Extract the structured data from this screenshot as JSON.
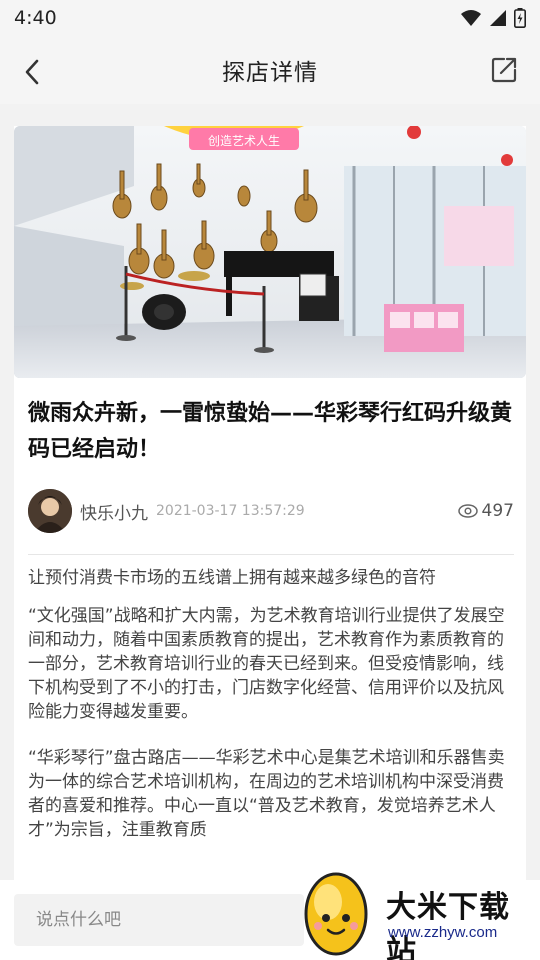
{
  "status_bar": {
    "time": "4:40"
  },
  "nav": {
    "title": "探店详情"
  },
  "article": {
    "title": "微雨众卉新，一雷惊蛰始——华彩琴行红码升级黄码已经启动！",
    "author": "快乐小九",
    "datetime": "2021-03-17 13:57:29",
    "views": "497",
    "hero_banner_text": "创造艺术人生",
    "paragraphs": [
      "让预付消费卡市场的五线谱上拥有越来越多绿色的音符",
      "“文化强国”战略和扩大内需，为艺术教育培训行业提供了发展空间和动力，随着中国素质教育的提出，艺术教育作为素质教育的一部分，艺术教育培训行业的春天已经到来。但受疫情影响，线下机构受到了不小的打击，门店数字化经营、信用评价以及抗风险能力变得越发重要。",
      "“华彩琴行”盘古路店——华彩艺术中心是集艺术培训和乐器售卖为一体的综合艺术培训机构，在周边的艺术培训机构中深受消费者的喜爱和推荐。中心一直以“普及艺术教育，发觉培养艺术人才”为宗旨，注重教育质"
    ]
  },
  "comment": {
    "placeholder": "说点什么吧"
  },
  "watermark": {
    "brand": "大米下载站",
    "url": "www.zzhyw.com"
  },
  "colors": {
    "header_bg": "#f5f5f5",
    "page_bg": "#f2f2f2",
    "text_dark": "#111111",
    "text_muted": "#aaaaaa"
  },
  "icons": {
    "back": "chevron-left-icon",
    "share": "share-external-icon",
    "views": "eye-icon",
    "wifi": "wifi-icon",
    "signal": "signal-icon",
    "battery": "battery-icon"
  }
}
